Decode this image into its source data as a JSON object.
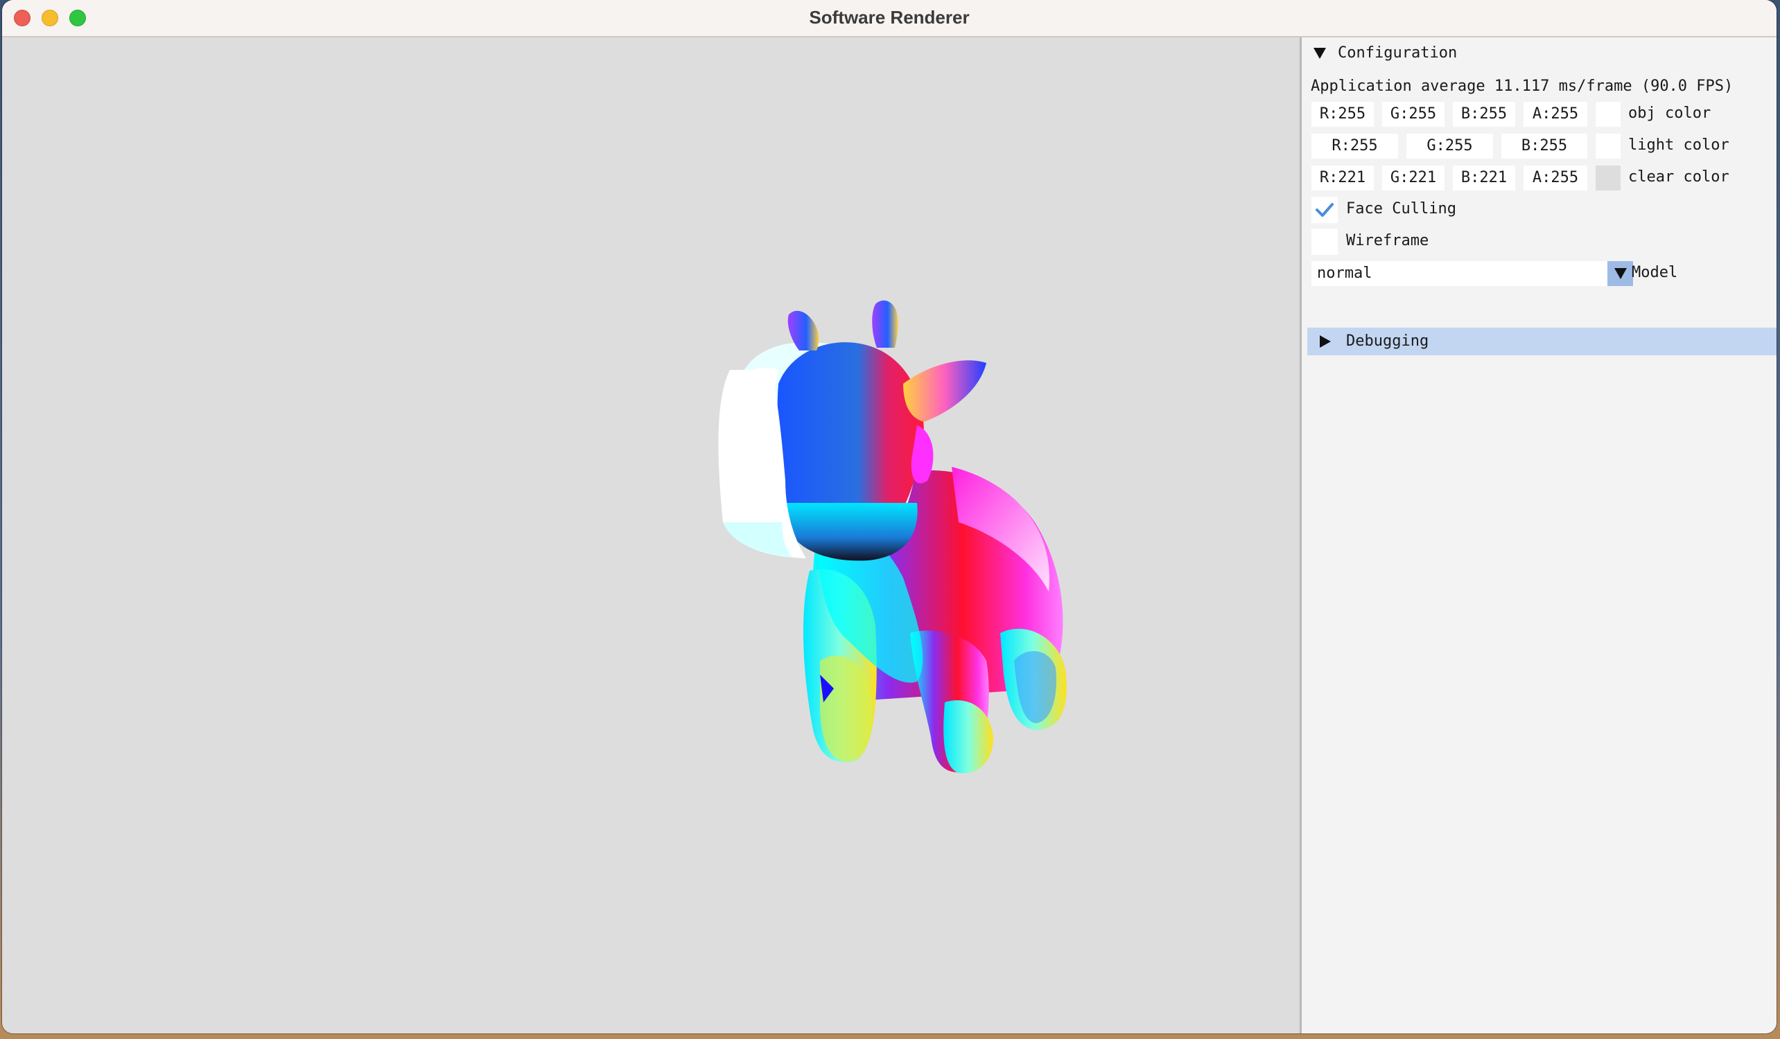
{
  "window": {
    "title": "Software Renderer"
  },
  "config": {
    "header_label": "Configuration",
    "fps_text": "Application average 11.117 ms/frame (90.0 FPS)",
    "obj_color": {
      "r": "R:255",
      "g": "G:255",
      "b": "B:255",
      "a": "A:255",
      "label": "obj color",
      "swatch": "#ffffff"
    },
    "light_color": {
      "r": "R:255",
      "g": "G:255",
      "b": "B:255",
      "label": "light color",
      "swatch": "#ffffff"
    },
    "clear_color": {
      "r": "R:221",
      "g": "G:221",
      "b": "B:221",
      "a": "A:255",
      "label": "clear color",
      "swatch": "#dddddd"
    },
    "face_culling": {
      "label": "Face Culling",
      "checked": true
    },
    "wireframe": {
      "label": "Wireframe",
      "checked": false
    },
    "model": {
      "value": "normal",
      "label": "Model"
    },
    "debugging_label": "Debugging"
  },
  "colors": {
    "viewport_bg": "#dddddd",
    "panel_bg": "#f3f3f3",
    "accent": "#4a8ddc",
    "selected_header": "#c2d6f2"
  },
  "icons": {
    "collapse": "triangle-down-icon",
    "expand": "triangle-right-icon",
    "check": "checkmark-icon",
    "combo": "triangle-down-icon"
  }
}
